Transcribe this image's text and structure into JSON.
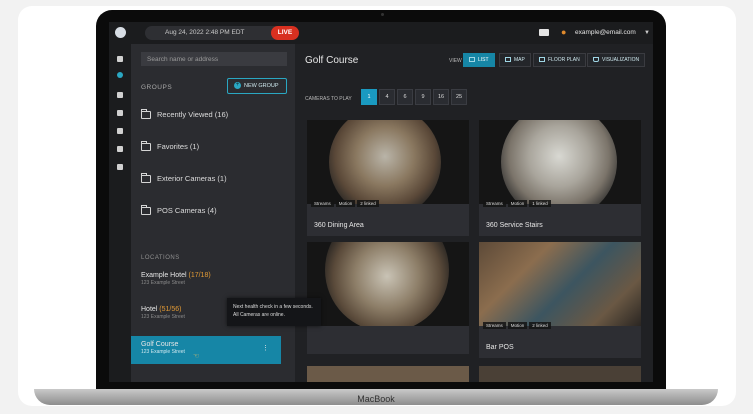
{
  "device": {
    "brand_label": "MacBook"
  },
  "topbar": {
    "datetime": "Aug 24, 2022 2:48 PM EDT",
    "live_label": "LIVE",
    "user_email": "example@email.com"
  },
  "rail": {
    "items": [
      "",
      "",
      "",
      "",
      "",
      "",
      ""
    ]
  },
  "sidebar": {
    "search_placeholder": "Search name or address",
    "groups_label": "GROUPS",
    "new_group_label": "NEW GROUP",
    "groups": [
      {
        "label": "Recently Viewed (16)"
      },
      {
        "label": "Favorites (1)"
      },
      {
        "label": "Exterior Cameras (1)"
      },
      {
        "label": "POS Cameras (4)"
      }
    ],
    "locations_label": "LOCATIONS",
    "locations": [
      {
        "name": "Example Hotel",
        "count": "(17/18)",
        "sub": "123 Example Street"
      },
      {
        "name": "Hotel",
        "count": "(51/56)",
        "sub": "123 Example Street"
      },
      {
        "name": "Golf Course",
        "count": "",
        "sub": "123 Example Street"
      }
    ]
  },
  "main": {
    "title": "Golf Course",
    "view_label": "VIEW",
    "view_tabs": [
      "LIST",
      "MAP",
      "FLOOR PLAN",
      "VISUALIZATION"
    ],
    "cameras_to_play_label": "CAMERAS TO PLAY",
    "play_counts": [
      "1",
      "4",
      "6",
      "9",
      "16",
      "25"
    ],
    "active_play_count": "1",
    "cameras": [
      {
        "name": "360 Dining Area",
        "chips": [
          "Streams",
          "Motion",
          "2 linked"
        ]
      },
      {
        "name": "360 Service Stairs",
        "chips": [
          "Streams",
          "Motion",
          "1 linked"
        ]
      },
      {
        "name": "",
        "chips": []
      },
      {
        "name": "Bar POS",
        "chips": [
          "Streams",
          "Motion",
          "2 linked"
        ]
      }
    ],
    "toast": {
      "line1": "Next health check in a few seconds.",
      "line2": "All Cameras are online."
    }
  },
  "colors": {
    "accent": "#1686a6",
    "live": "#d83020",
    "background": "#232427"
  }
}
